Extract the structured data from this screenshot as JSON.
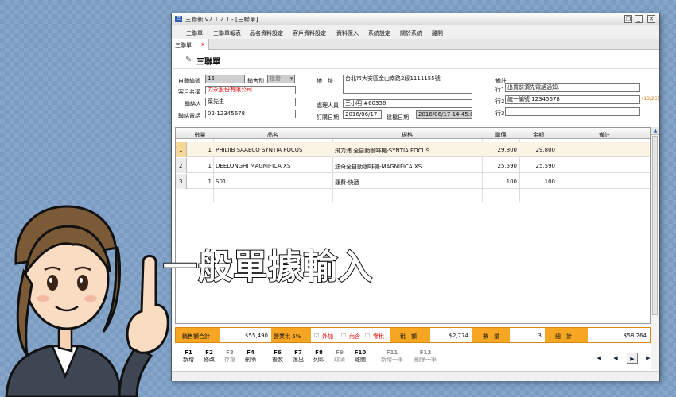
{
  "window": {
    "title": "三聯新 v2.1.2.1 - [三聯單]"
  },
  "menu": [
    "三聯單",
    "三聯單報表",
    "品名資料設定",
    "客戶資料設定",
    "資料匯入",
    "系統設定",
    "關於系統",
    "離開"
  ],
  "tab": {
    "label": "三聯單",
    "close": "x"
  },
  "page": {
    "title": "三聯單"
  },
  "form": {
    "id_label": "自動編號",
    "id_value": "15",
    "sales_label": "銷售別",
    "sales_value": "批發",
    "customer_label": "客戶名稱",
    "customer_value": "力永股份有限公司",
    "contact_label": "聯絡人",
    "contact_value": "葉先生",
    "phone_label": "聯絡電話",
    "phone_value": "02-12345678",
    "address_label": "地　址",
    "address_value": "台北市大安區金山南路2段1111155號",
    "handler_label": "處理人員",
    "handler_value": "王小明 #60356",
    "order_date_label": "訂購日期",
    "order_date_value": "2016/06/17",
    "build_date_label": "建檔日期",
    "build_date_value": "2016/06/17 14:45:03",
    "remarks_label": "備註",
    "remark1_label": "行1",
    "remark1_value": "出貨前須先電話通知.",
    "remark2_label": "行2",
    "remark2_value": "統一編號 12345678",
    "remark2_count": "(13/25)",
    "remark3_label": "行3",
    "remark3_value": ""
  },
  "table": {
    "headers": [
      "數量",
      "品名",
      "規格",
      "單價",
      "金額",
      "備註"
    ],
    "rows": [
      {
        "no": "1",
        "qty": "1",
        "name": "PHILIIB SAAECO SYNTIA FOCUS",
        "spec": "飛力浦 全自動咖啡機-SYNTIA FOCUS",
        "price": "29,800",
        "amount": "29,800",
        "note": ""
      },
      {
        "no": "2",
        "qty": "1",
        "name": "DEELONGHI MAGNIFICA XS",
        "spec": "迪奇全自動咖啡機-MAGNIFICA XS",
        "price": "25,590",
        "amount": "25,590",
        "note": ""
      },
      {
        "no": "3",
        "qty": "1",
        "name": "S01",
        "spec": "運費-快遞",
        "price": "100",
        "amount": "100",
        "note": ""
      }
    ]
  },
  "summary": {
    "sales_total_label": "銷售額合計",
    "sales_total": "$55,490",
    "tax_rate_label": "營業稅 5%",
    "tax_ext": "外加",
    "tax_inc": "內含",
    "tax_exempt": "零稅",
    "tax_label": "稅　額",
    "tax": "$2,774",
    "qty_label": "數　量",
    "qty": "3",
    "total_label": "總　計",
    "total": "$58,264"
  },
  "fkeys": [
    {
      "key": "F1",
      "label": "新增",
      "enabled": true
    },
    {
      "key": "F2",
      "label": "修改",
      "enabled": true
    },
    {
      "key": "F3",
      "label": "存檔",
      "enabled": false
    },
    {
      "key": "F4",
      "label": "刪除",
      "enabled": true
    },
    {
      "key": "F6",
      "label": "複製",
      "enabled": true
    },
    {
      "key": "F7",
      "label": "匯出",
      "enabled": true
    },
    {
      "key": "F8",
      "label": "列印",
      "enabled": true
    },
    {
      "key": "F9",
      "label": "取消",
      "enabled": false
    },
    {
      "key": "F10",
      "label": "離開",
      "enabled": true
    },
    {
      "key": "F11",
      "label": "新增一筆",
      "enabled": false
    },
    {
      "key": "F12",
      "label": "刪除一筆",
      "enabled": false
    }
  ],
  "nav": {
    "first": "|◀",
    "prev": "◀",
    "next": "▶",
    "last": "▶|"
  },
  "overlay": {
    "text": "一般單據輸入"
  },
  "colors": {
    "accent": "#f6a623",
    "tax_red": "#d00000",
    "remark_count": "#e07000"
  }
}
